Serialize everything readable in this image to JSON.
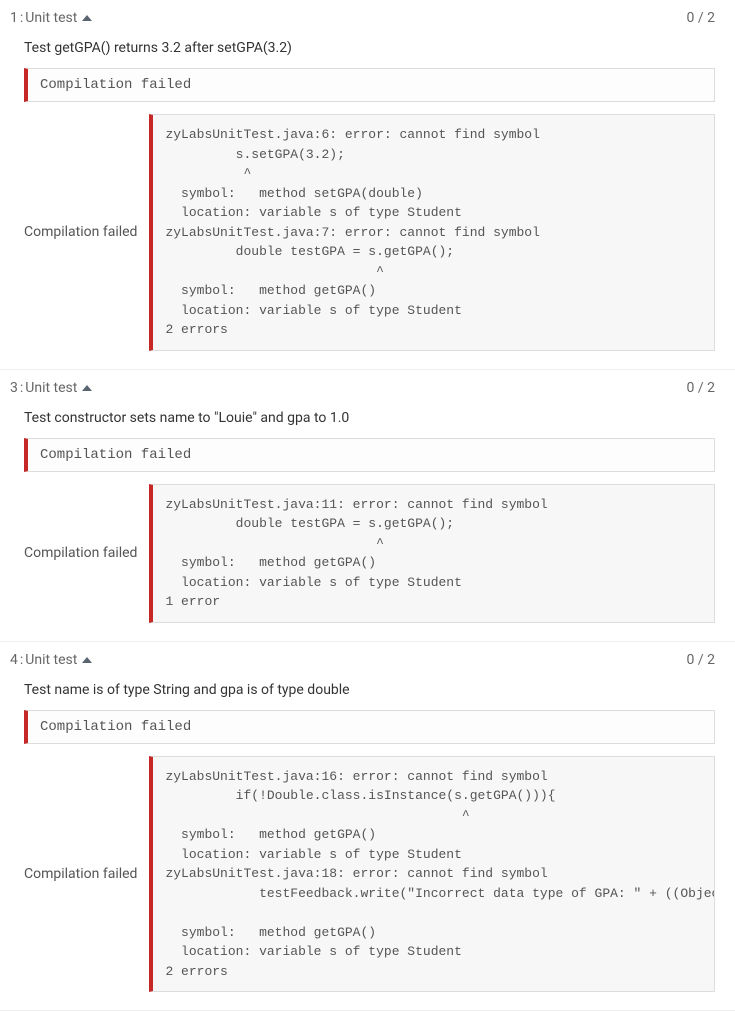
{
  "tests": [
    {
      "number": "1",
      "label": "Unit test",
      "score": "0 / 2",
      "description": "Test getGPA() returns 3.2 after setGPA(3.2)",
      "banner": "Compilation failed",
      "outputLabel": "Compilation failed",
      "code": "zyLabsUnitTest.java:6: error: cannot find symbol\n         s.setGPA(3.2);\n          ^\n  symbol:   method setGPA(double)\n  location: variable s of type Student\nzyLabsUnitTest.java:7: error: cannot find symbol\n         double testGPA = s.getGPA();\n                           ^\n  symbol:   method getGPA()\n  location: variable s of type Student\n2 errors",
      "wide": false
    },
    {
      "number": "3",
      "label": "Unit test",
      "score": "0 / 2",
      "description": "Test constructor sets name to \"Louie\" and gpa to 1.0",
      "banner": "Compilation failed",
      "outputLabel": "Compilation failed",
      "code": "zyLabsUnitTest.java:11: error: cannot find symbol\n         double testGPA = s.getGPA();\n                           ^\n  symbol:   method getGPA()\n  location: variable s of type Student\n1 error",
      "wide": false
    },
    {
      "number": "4",
      "label": "Unit test",
      "score": "0 / 2",
      "description": "Test name is of type String and gpa is of type double",
      "banner": "Compilation failed",
      "outputLabel": "Compilation failed",
      "code": "zyLabsUnitTest.java:16: error: cannot find symbol\n         if(!Double.class.isInstance(s.getGPA())){\n                                      ^\n  symbol:   method getGPA()\n  location: variable s of type Student\nzyLabsUnitTest.java:18: error: cannot find symbol\n            testFeedback.write(\"Incorrect data type of GPA: \" + ((Object)s.getGPA()).getClass().getName());\n                                                                          ^\n  symbol:   method getGPA()\n  location: variable s of type Student\n2 errors",
      "wide": true
    }
  ]
}
